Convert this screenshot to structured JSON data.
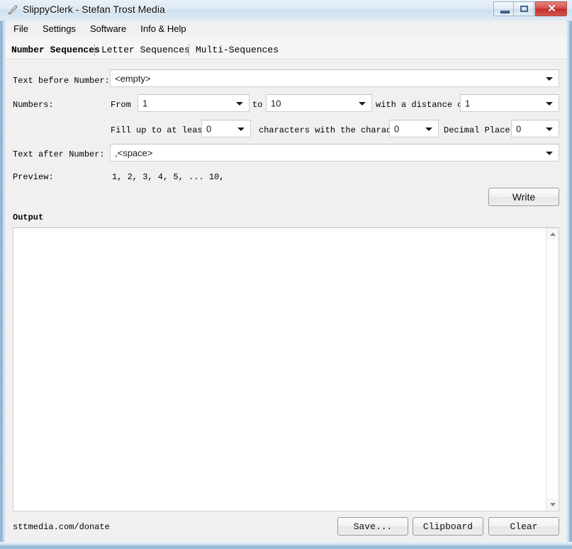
{
  "window": {
    "title": "SlippyClerk - Stefan Trost Media",
    "icon": "app-rocket-icon",
    "buttons": {
      "minimize": "minimize",
      "maximize": "maximize",
      "close": "✕"
    }
  },
  "menubar": {
    "items": [
      {
        "label": "File"
      },
      {
        "label": "Settings"
      },
      {
        "label": "Software"
      },
      {
        "label": "Info & Help"
      }
    ]
  },
  "tabs": [
    {
      "label": "Number Sequences",
      "selected": true
    },
    {
      "label": "Letter Sequences",
      "selected": false
    },
    {
      "label": "Multi-Sequences",
      "selected": false
    }
  ],
  "form": {
    "text_before_label": "Text before Number:",
    "text_before_value": "<empty>",
    "numbers_label": "Numbers:",
    "from_label": "From",
    "from_value": "1",
    "to_label": "to",
    "to_value": "10",
    "distance_label": "with a distance of",
    "distance_value": "1",
    "fillup_label": "Fill up to at least",
    "fillup_value": "0",
    "characters_label": "characters with the character",
    "character_value": "0",
    "decimal_label": "Decimal Places:",
    "decimal_value": "0",
    "text_after_label": "Text after Number:",
    "text_after_value": ",<space>",
    "preview_label": "Preview:",
    "preview_value": "1, 2, 3, 4, 5, ... 10,"
  },
  "actions": {
    "write": "Write"
  },
  "output": {
    "group_label": "Output",
    "content": ""
  },
  "footer": {
    "donate_link": "sttmedia.com/donate",
    "save": "Save...",
    "clipboard": "Clipboard",
    "clear": "Clear"
  },
  "colors": {
    "frame_blue": "#7fa8cc",
    "close_red": "#bf2f28",
    "client_bg": "#f0f0f0",
    "field_bg": "#ffffff"
  }
}
